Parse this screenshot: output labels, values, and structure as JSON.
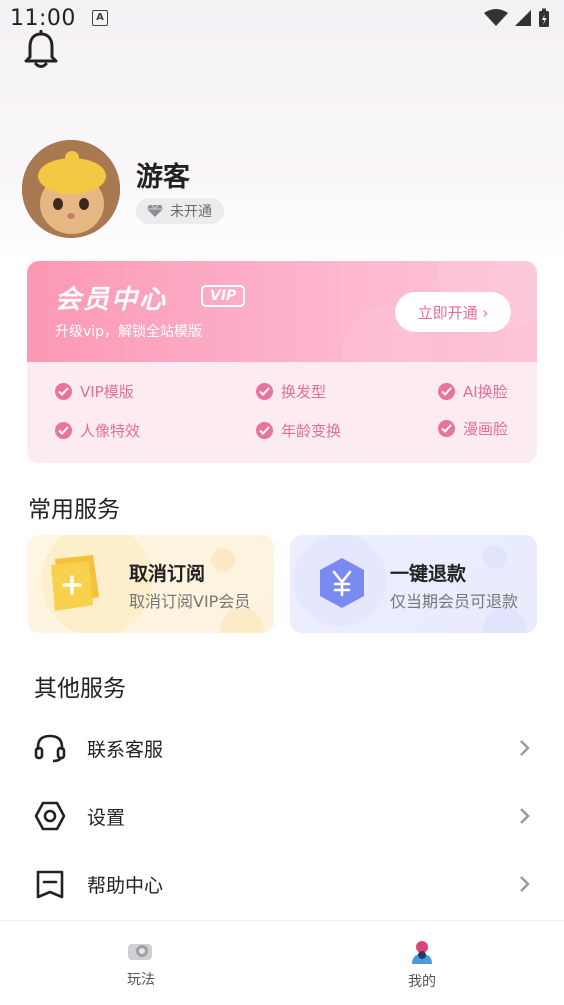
{
  "status_bar": {
    "time": "11:00",
    "notif_icon": "A"
  },
  "profile": {
    "name": "游客",
    "vip_state": "未开通"
  },
  "vip_card": {
    "title": "会员中心",
    "badge": "VIP",
    "subtitle": "升级vip，解锁全站模版",
    "open_button": "立即开通 ›",
    "features": [
      "VIP模版",
      "换发型",
      "AI换脸",
      "人像特效",
      "年龄变换",
      "漫画脸"
    ]
  },
  "common_services": {
    "title": "常用服务",
    "items": [
      {
        "title": "取消订阅",
        "subtitle": "取消订阅VIP会员",
        "icon": "plus-card-icon"
      },
      {
        "title": "一键退款",
        "subtitle": "仅当期会员可退款",
        "icon": "yuan-hexagon-icon"
      }
    ]
  },
  "other_services": {
    "title": "其他服务",
    "items": [
      {
        "label": "联系客服",
        "icon": "headset-icon"
      },
      {
        "label": "设置",
        "icon": "hexagon-settings-icon"
      },
      {
        "label": "帮助中心",
        "icon": "help-book-icon"
      }
    ]
  },
  "tabbar": {
    "tabs": [
      {
        "label": "玩法",
        "active": false
      },
      {
        "label": "我的",
        "active": true
      }
    ]
  },
  "colors": {
    "accent_pink": "#e8739c",
    "vip_gradient_start": "#fc98b5",
    "vip_gradient_end": "#fdc5d8"
  }
}
